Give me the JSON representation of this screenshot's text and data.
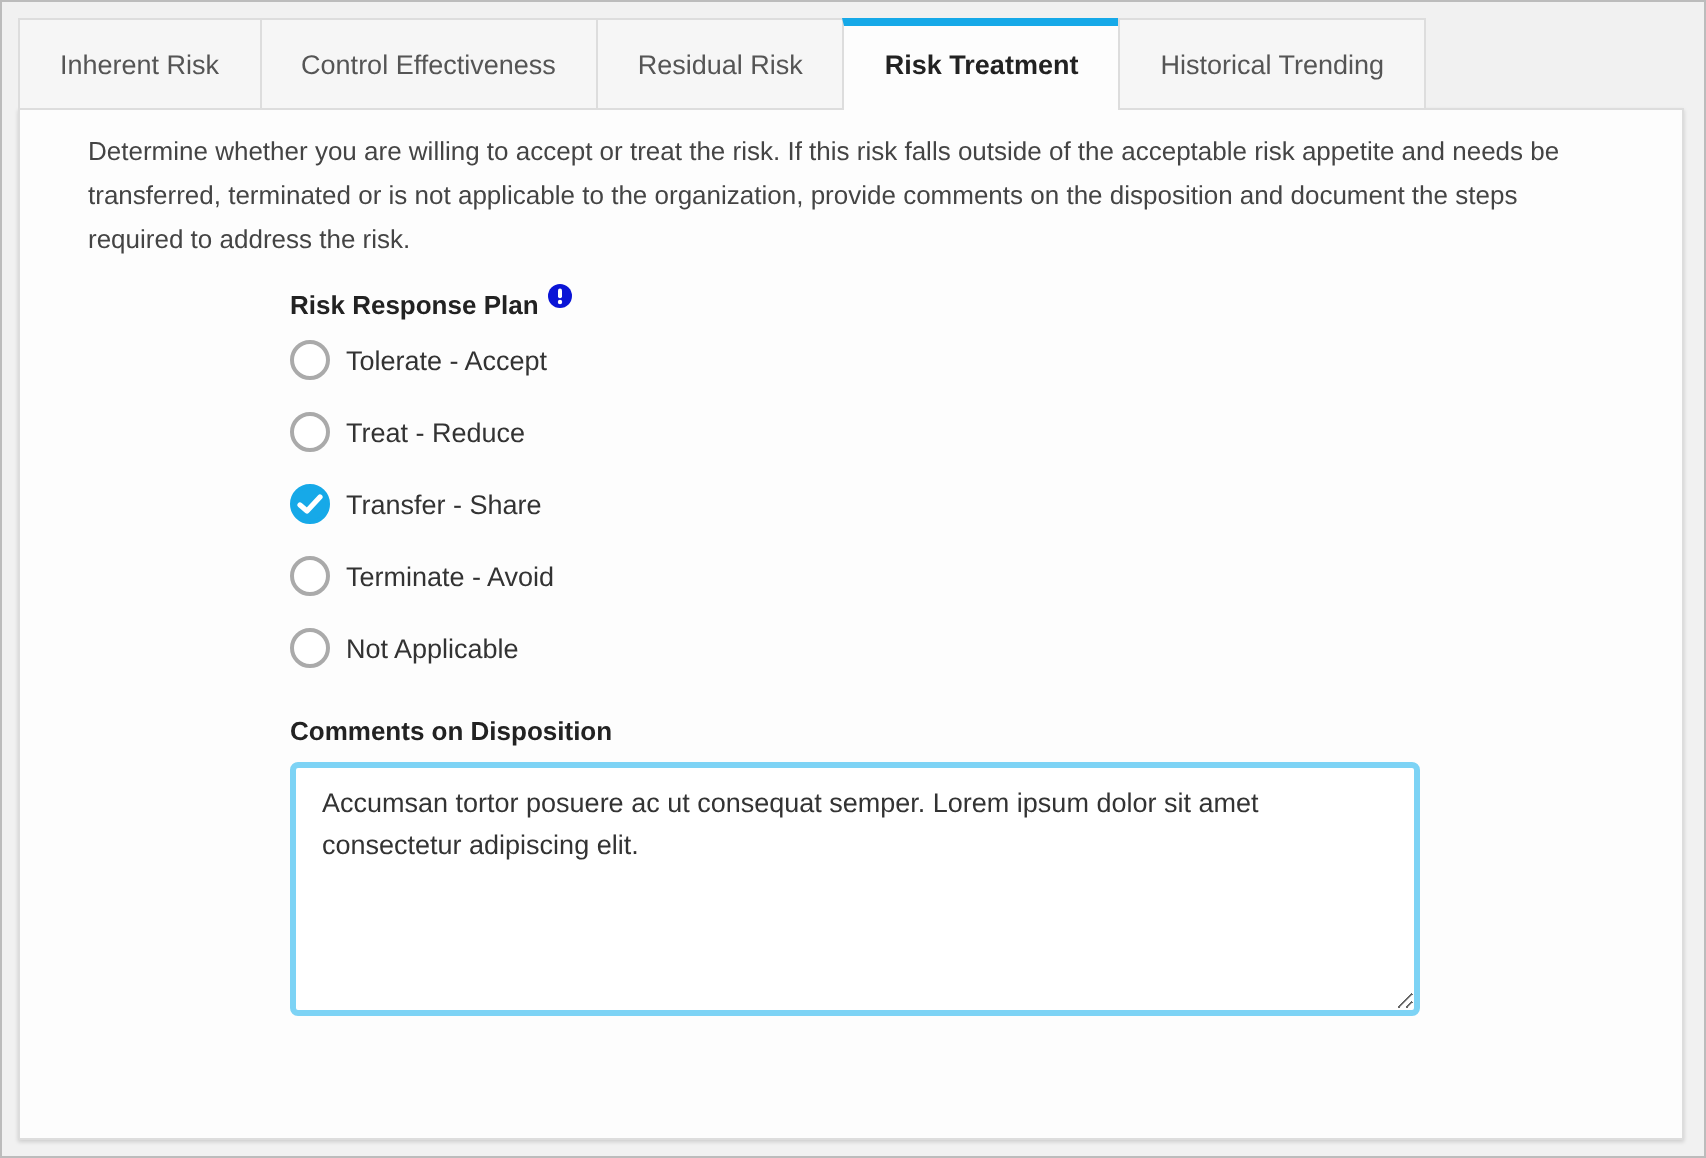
{
  "tabs": [
    {
      "label": "Inherent Risk",
      "selected": false
    },
    {
      "label": "Control Effectiveness",
      "selected": false
    },
    {
      "label": "Residual Risk",
      "selected": false
    },
    {
      "label": "Risk Treatment",
      "selected": true
    },
    {
      "label": "Historical Trending",
      "selected": false
    }
  ],
  "description": "Determine whether you are willing to accept or treat the risk. If this risk falls outside of the acceptable risk appetite and needs be transferred, terminated or is not applicable to the organization, provide comments on the disposition and document the steps required to address the risk.",
  "response_plan": {
    "label": "Risk Response Plan",
    "required": true,
    "options": [
      {
        "label": "Tolerate - Accept",
        "selected": false
      },
      {
        "label": "Treat - Reduce",
        "selected": false
      },
      {
        "label": "Transfer - Share",
        "selected": true
      },
      {
        "label": "Terminate - Avoid",
        "selected": false
      },
      {
        "label": "Not Applicable",
        "selected": false
      }
    ]
  },
  "comments": {
    "label": "Comments on Disposition",
    "value": "Accumsan tortor posuere ac ut consequat semper. Lorem ipsum dolor sit amet consectetur adipiscing elit.",
    "focused": true
  }
}
